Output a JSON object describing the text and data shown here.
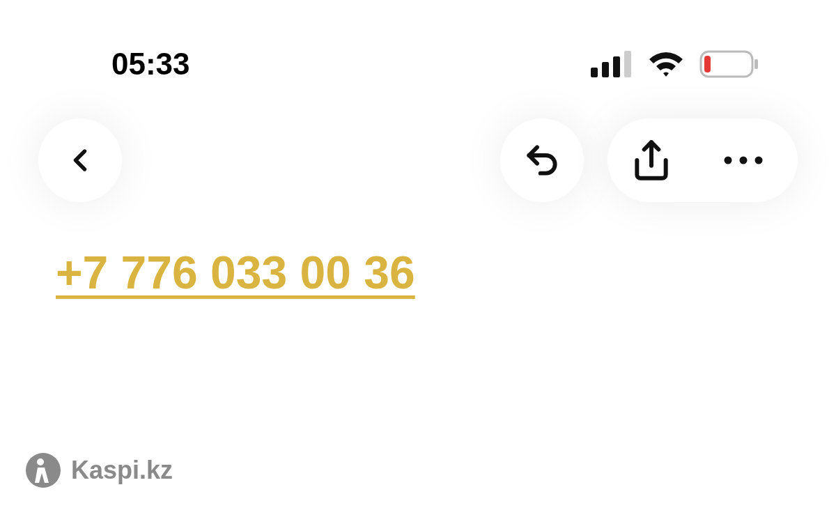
{
  "status_bar": {
    "time": "05:33"
  },
  "message": {
    "phone_link": "+7 776 033 00 36"
  },
  "footer": {
    "brand": "Kaspi.kz"
  }
}
